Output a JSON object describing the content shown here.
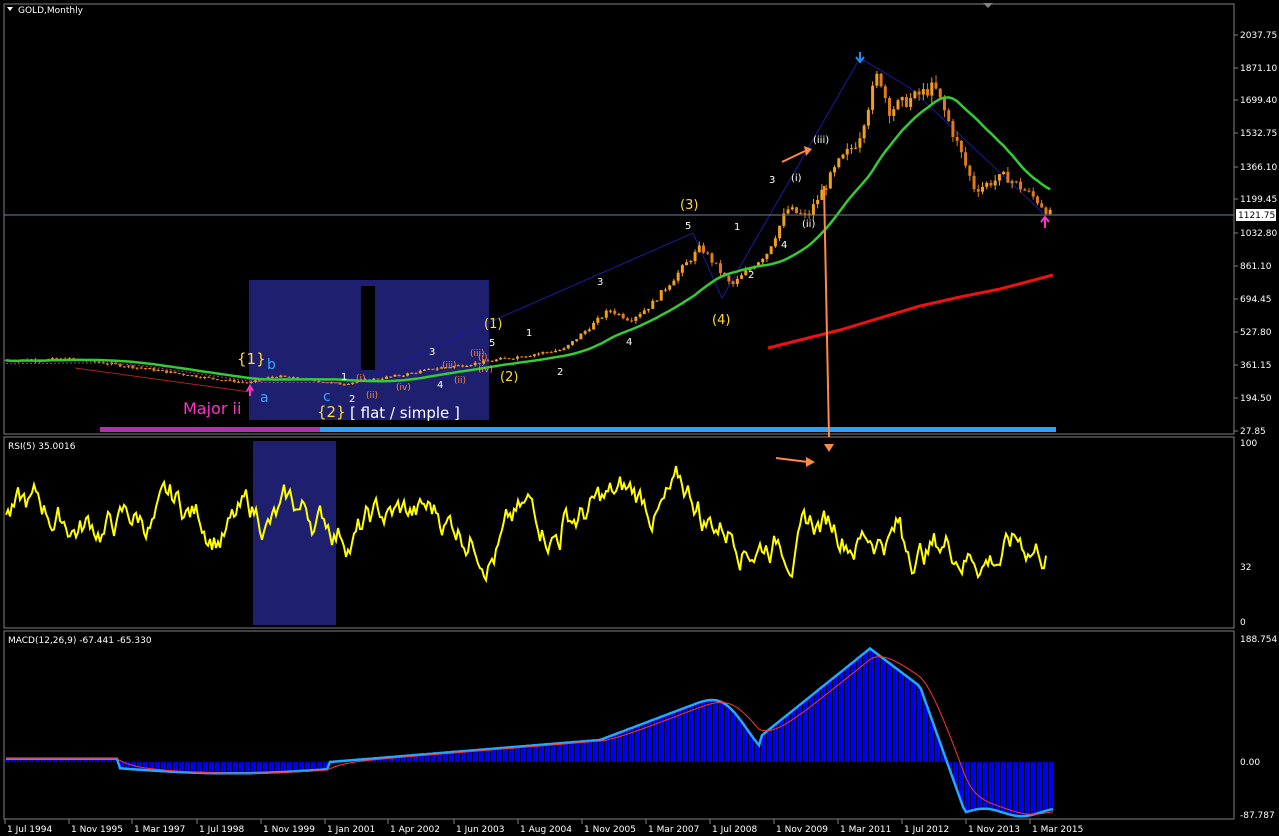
{
  "window": {
    "title": "GOLD,Monthly",
    "menu_icon": "triangle-down-icon"
  },
  "price_panel": {
    "current_price": "1121.75",
    "y_ticks": [
      "2037.75",
      "1871.10",
      "1699.40",
      "1532.75",
      "1366.10",
      "1199.45",
      "1032.80",
      "861.10",
      "694.45",
      "527.80",
      "361.15",
      "194.50",
      "27.85"
    ],
    "annotations": {
      "major_ii": "Major ii",
      "wave_1_curly": "{1}",
      "wave_2_curly": "{2}",
      "flat_simple": "[ flat / simple ]",
      "a": "a",
      "b": "b",
      "c": "c",
      "w1_small": "1",
      "w2_small": "2",
      "w3_small": "3",
      "w4_small": "4",
      "w5_small": "5",
      "i_small": "(i)",
      "ii_small": "(ii)",
      "iii_small": "(iii)",
      "iv_small": "(iv)",
      "i_orange": "(i)",
      "ii_orange": "(ii)",
      "iii_orange": "(iii)",
      "iv_orange": "(iv)",
      "p1": "(1)",
      "p2": "(2)",
      "p3": "(3)",
      "p4": "(4)",
      "m1": "1",
      "m2": "2",
      "m3": "3",
      "m4": "4",
      "m5": "5",
      "n1": "1",
      "n2": "2",
      "n3": "3",
      "n4": "4",
      "hi_i": "(i)",
      "hi_ii": "(ii)",
      "hi_iii": "(iii)"
    },
    "colors": {
      "candle_up": "#f0a020",
      "candle_down": "#e07a20",
      "ma_fast": "#33cc33",
      "ma_slow": "#ee1111",
      "wave_line": "#1a1aa0",
      "box": "#1f1f70",
      "arrow": "#ff8844"
    }
  },
  "rsi_panel": {
    "label": "RSI(5) 35.0016",
    "ticks": [
      "100",
      "32",
      "0"
    ],
    "color": "#ffff00"
  },
  "macd_panel": {
    "label": "MACD(12,26,9) -67.441 -65.330",
    "ticks": [
      "188.754",
      "0.00",
      "-87.787"
    ],
    "colors": {
      "hist": "#0000ff",
      "main": "#22aaff",
      "signal": "#ff3333"
    }
  },
  "x_axis": {
    "labels": [
      "1 Jul 1994",
      "1 Nov 1995",
      "1 Mar 1997",
      "1 Jul 1998",
      "1 Nov 1999",
      "1 Jan 2001",
      "1 Apr 2002",
      "1 Jun 2003",
      "1 Aug 2004",
      "1 Nov 2005",
      "1 Mar 2007",
      "1 Jul 2008",
      "1 Nov 2009",
      "1 Mar 2011",
      "1 Jul 2012",
      "1 Nov 2013",
      "1 Mar 2015"
    ]
  },
  "chart_data": {
    "type": "line",
    "title": "GOLD,Monthly",
    "x": [
      "1994",
      "1995",
      "1996",
      "1997",
      "1998",
      "1999",
      "2000",
      "2001",
      "2002",
      "2003",
      "2004",
      "2005",
      "2006",
      "2007",
      "2008",
      "2009",
      "2010",
      "2011",
      "2012",
      "2013",
      "2014",
      "2015"
    ],
    "series": [
      {
        "name": "GOLD",
        "values": [
          385,
          385,
          375,
          340,
          295,
          280,
          280,
          270,
          310,
          350,
          400,
          440,
          600,
          680,
          870,
          1000,
          1250,
          1650,
          1670,
          1300,
          1200,
          1121.75
        ]
      }
    ],
    "ylim": [
      27.85,
      2037.75
    ],
    "indicators": {
      "rsi_period": 5,
      "rsi_last": 35.0016,
      "macd_params": [
        12,
        26,
        9
      ],
      "macd_main_last": -67.441,
      "macd_signal_last": -65.33
    }
  }
}
